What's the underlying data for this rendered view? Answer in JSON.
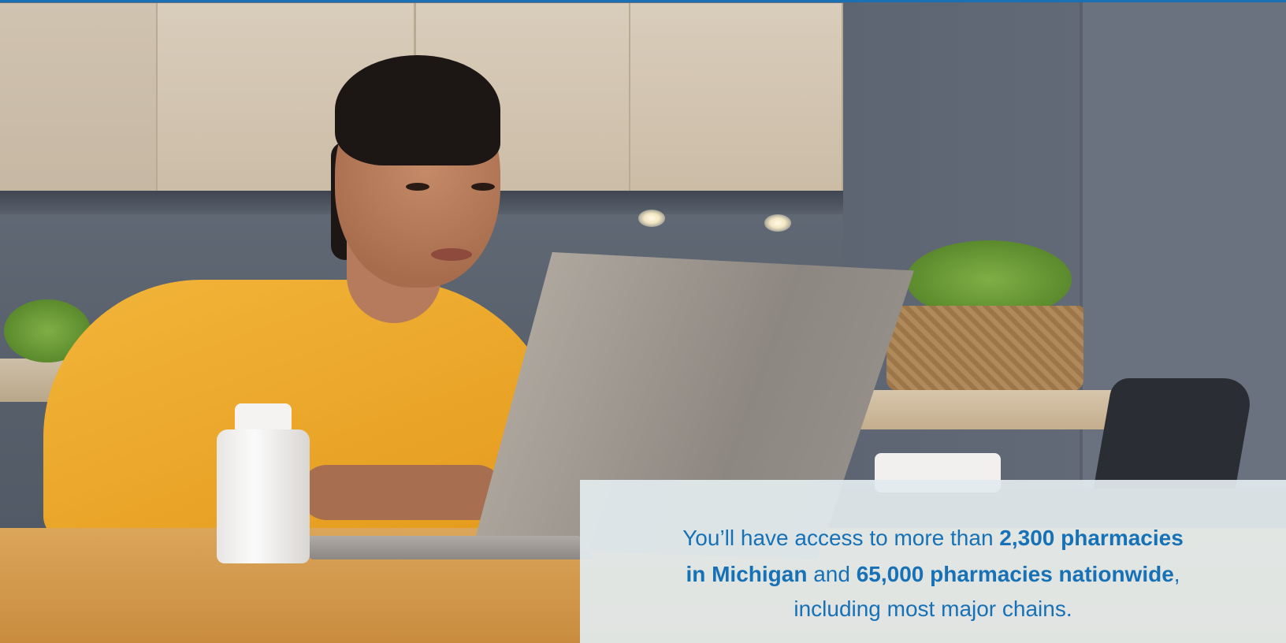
{
  "caption": {
    "line1_pre": "You’ll have access to more than ",
    "line1_bold": "2,300 pharmacies",
    "line2_bold1": "in Michigan",
    "line2_mid": " and ",
    "line2_bold2": "65,000 pharmacies nationwide",
    "line2_end": ",",
    "line3": "including most major chains."
  },
  "colors": {
    "caption_text": "#1671b6",
    "caption_bg": "#e2ebee",
    "top_accent": "#1b6fb3"
  }
}
